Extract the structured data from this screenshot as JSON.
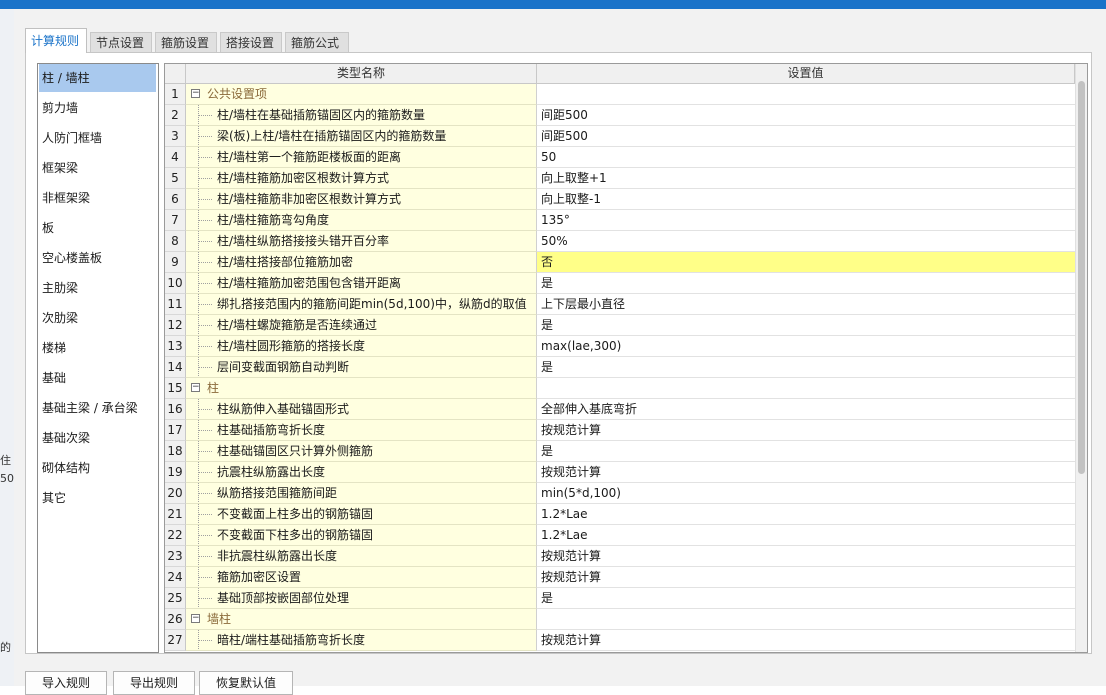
{
  "tabs": [
    {
      "label": "计算规则",
      "active": true
    },
    {
      "label": "节点设置",
      "active": false
    },
    {
      "label": "箍筋设置",
      "active": false
    },
    {
      "label": "搭接设置",
      "active": false
    },
    {
      "label": "箍筋公式",
      "active": false
    }
  ],
  "categories": [
    {
      "label": "柱 / 墙柱",
      "selected": true
    },
    {
      "label": "剪力墙"
    },
    {
      "label": "人防门框墙"
    },
    {
      "label": "框架梁"
    },
    {
      "label": "非框架梁"
    },
    {
      "label": "板"
    },
    {
      "label": "空心楼盖板"
    },
    {
      "label": "主肋梁"
    },
    {
      "label": "次肋梁"
    },
    {
      "label": "楼梯"
    },
    {
      "label": "基础"
    },
    {
      "label": "基础主梁 / 承台梁"
    },
    {
      "label": "基础次梁"
    },
    {
      "label": "砌体结构"
    },
    {
      "label": "其它"
    }
  ],
  "grid": {
    "columns": [
      "类型名称",
      "设置值"
    ],
    "rows": [
      {
        "no": "1",
        "name": "公共设置项",
        "value": "",
        "group": true
      },
      {
        "no": "2",
        "name": "柱/墙柱在基础插筋锚固区内的箍筋数量",
        "value": "间距500"
      },
      {
        "no": "3",
        "name": "梁(板)上柱/墙柱在插筋锚固区内的箍筋数量",
        "value": "间距500"
      },
      {
        "no": "4",
        "name": "柱/墙柱第一个箍筋距楼板面的距离",
        "value": "50"
      },
      {
        "no": "5",
        "name": "柱/墙柱箍筋加密区根数计算方式",
        "value": "向上取整+1"
      },
      {
        "no": "6",
        "name": "柱/墙柱箍筋非加密区根数计算方式",
        "value": "向上取整-1"
      },
      {
        "no": "7",
        "name": "柱/墙柱箍筋弯勾角度",
        "value": "135°"
      },
      {
        "no": "8",
        "name": "柱/墙柱纵筋搭接接头错开百分率",
        "value": "50%"
      },
      {
        "no": "9",
        "name": "柱/墙柱搭接部位箍筋加密",
        "value": "否",
        "highlight": true
      },
      {
        "no": "10",
        "name": "柱/墙柱箍筋加密范围包含错开距离",
        "value": "是"
      },
      {
        "no": "11",
        "name": "绑扎搭接范围内的箍筋间距min(5d,100)中，纵筋d的取值",
        "value": "上下层最小直径"
      },
      {
        "no": "12",
        "name": "柱/墙柱螺旋箍筋是否连续通过",
        "value": "是"
      },
      {
        "no": "13",
        "name": "柱/墙柱圆形箍筋的搭接长度",
        "value": "max(lae,300)"
      },
      {
        "no": "14",
        "name": "层间变截面钢筋自动判断",
        "value": "是"
      },
      {
        "no": "15",
        "name": "柱",
        "value": "",
        "group": true
      },
      {
        "no": "16",
        "name": "柱纵筋伸入基础锚固形式",
        "value": "全部伸入基底弯折"
      },
      {
        "no": "17",
        "name": "柱基础插筋弯折长度",
        "value": "按规范计算"
      },
      {
        "no": "18",
        "name": "柱基础锚固区只计算外侧箍筋",
        "value": "是"
      },
      {
        "no": "19",
        "name": "抗震柱纵筋露出长度",
        "value": "按规范计算"
      },
      {
        "no": "20",
        "name": "纵筋搭接范围箍筋间距",
        "value": "min(5*d,100)"
      },
      {
        "no": "21",
        "name": "不变截面上柱多出的钢筋锚固",
        "value": "1.2*Lae"
      },
      {
        "no": "22",
        "name": "不变截面下柱多出的钢筋锚固",
        "value": "1.2*Lae"
      },
      {
        "no": "23",
        "name": "非抗震柱纵筋露出长度",
        "value": "按规范计算"
      },
      {
        "no": "24",
        "name": "箍筋加密区设置",
        "value": "按规范计算"
      },
      {
        "no": "25",
        "name": "基础顶部按嵌固部位处理",
        "value": "是"
      },
      {
        "no": "26",
        "name": "墙柱",
        "value": "",
        "group": true
      },
      {
        "no": "27",
        "name": "暗柱/端柱基础插筋弯折长度",
        "value": "按规范计算"
      }
    ]
  },
  "buttons": [
    {
      "label": "导入规则"
    },
    {
      "label": "导出规则"
    },
    {
      "label": "恢复默认值"
    }
  ],
  "background_fragments": [
    "住",
    "50",
    "的"
  ]
}
